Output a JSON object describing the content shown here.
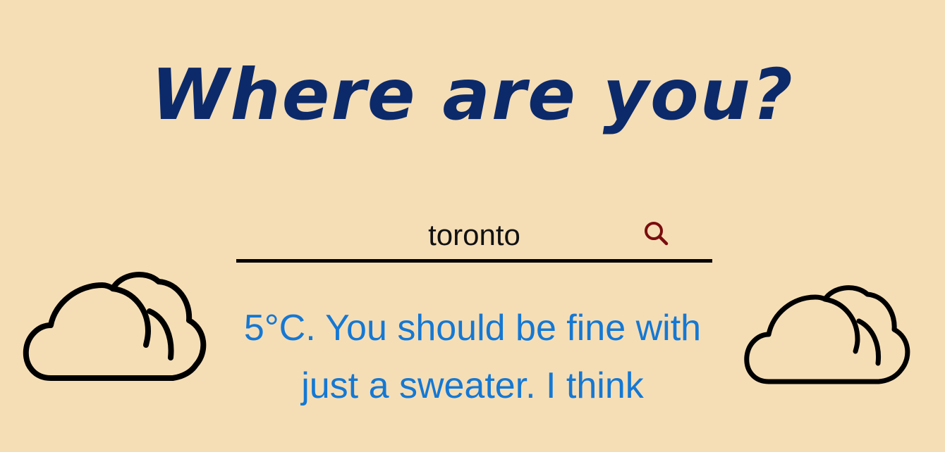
{
  "heading": "Where are you?",
  "search": {
    "value": "toronto",
    "icon": "search-icon",
    "icon_color": "#7a0d0d"
  },
  "message": {
    "line1": "5°C. You should be fine with",
    "line2": "just a sweater. I think"
  },
  "decorations": {
    "left_icon": "cloud-icon",
    "right_icon": "cloud-icon"
  },
  "colors": {
    "background": "#f5deb6",
    "heading": "#0c2a6a",
    "message": "#1478d4"
  }
}
